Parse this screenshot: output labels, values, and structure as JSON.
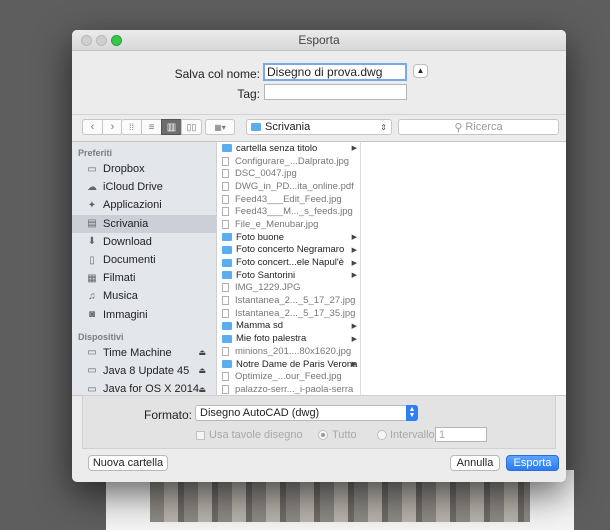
{
  "window": {
    "title": "Esporta"
  },
  "save": {
    "label": "Salva col nome:",
    "value": "Disegno di prova.dwg",
    "tag_label": "Tag:",
    "tag_value": ""
  },
  "location": {
    "current": "Scrivania",
    "search_placeholder": "Ricerca"
  },
  "sidebar": {
    "favorites_header": "Preferiti",
    "favorites": [
      {
        "label": "Dropbox",
        "icon": "folder-icon"
      },
      {
        "label": "iCloud Drive",
        "icon": "cloud-icon"
      },
      {
        "label": "Applicazioni",
        "icon": "applications-icon"
      },
      {
        "label": "Scrivania",
        "icon": "desktop-icon",
        "selected": true
      },
      {
        "label": "Download",
        "icon": "download-icon"
      },
      {
        "label": "Documenti",
        "icon": "documents-icon"
      },
      {
        "label": "Filmati",
        "icon": "movies-icon"
      },
      {
        "label": "Musica",
        "icon": "music-icon"
      },
      {
        "label": "Immagini",
        "icon": "pictures-icon"
      }
    ],
    "devices_header": "Dispositivi",
    "devices": [
      {
        "label": "Time Machine",
        "icon": "drive-icon",
        "eject": true
      },
      {
        "label": "Java 8 Update 45",
        "icon": "drive-icon",
        "eject": true
      },
      {
        "label": "Java for OS X 2014",
        "icon": "drive-icon",
        "eject": true
      }
    ]
  },
  "files": [
    {
      "name": "cartella senza titolo",
      "type": "folder"
    },
    {
      "name": "Configurare_...Dalprato.jpg",
      "type": "file"
    },
    {
      "name": "DSC_0047.jpg",
      "type": "file"
    },
    {
      "name": "DWG_in_PD...ita_online.pdf",
      "type": "file"
    },
    {
      "name": "Feed43___Edit_Feed.jpg",
      "type": "file"
    },
    {
      "name": "Feed43___M..._s_feeds.jpg",
      "type": "file"
    },
    {
      "name": "File_e_Menubar.jpg",
      "type": "file"
    },
    {
      "name": "Foto buone",
      "type": "folder"
    },
    {
      "name": "Foto concerto Negramaro",
      "type": "folder"
    },
    {
      "name": "Foto concert...ele Napul'è",
      "type": "folder"
    },
    {
      "name": "Foto Santorini",
      "type": "folder"
    },
    {
      "name": "IMG_1229.JPG",
      "type": "file"
    },
    {
      "name": "Istantanea_2..._5_17_27.jpg",
      "type": "file"
    },
    {
      "name": "Istantanea_2..._5_17_35.jpg",
      "type": "file"
    },
    {
      "name": "Mamma sd",
      "type": "folder"
    },
    {
      "name": "Mie foto palestra",
      "type": "folder"
    },
    {
      "name": "minions_201....80x1620.jpg",
      "type": "file"
    },
    {
      "name": "Notre Dame de Paris Verona",
      "type": "folder"
    },
    {
      "name": "Optimize_...our_Feed.jpg",
      "type": "file"
    },
    {
      "name": "palazzo-serr..._i-paola-serra",
      "type": "file"
    }
  ],
  "options": {
    "format_label": "Formato:",
    "format_value": "Disegno AutoCAD (dwg)",
    "use_layouts": "Usa tavole disegno",
    "all": "Tutto",
    "range": "Intervallo:",
    "range_value": "1"
  },
  "buttons": {
    "new_folder": "Nuova cartella",
    "cancel": "Annulla",
    "export": "Esporta"
  },
  "colors": {
    "accent": "#2a7cf3",
    "folder": "#5aaef0",
    "selection": "#cbd0d8"
  }
}
